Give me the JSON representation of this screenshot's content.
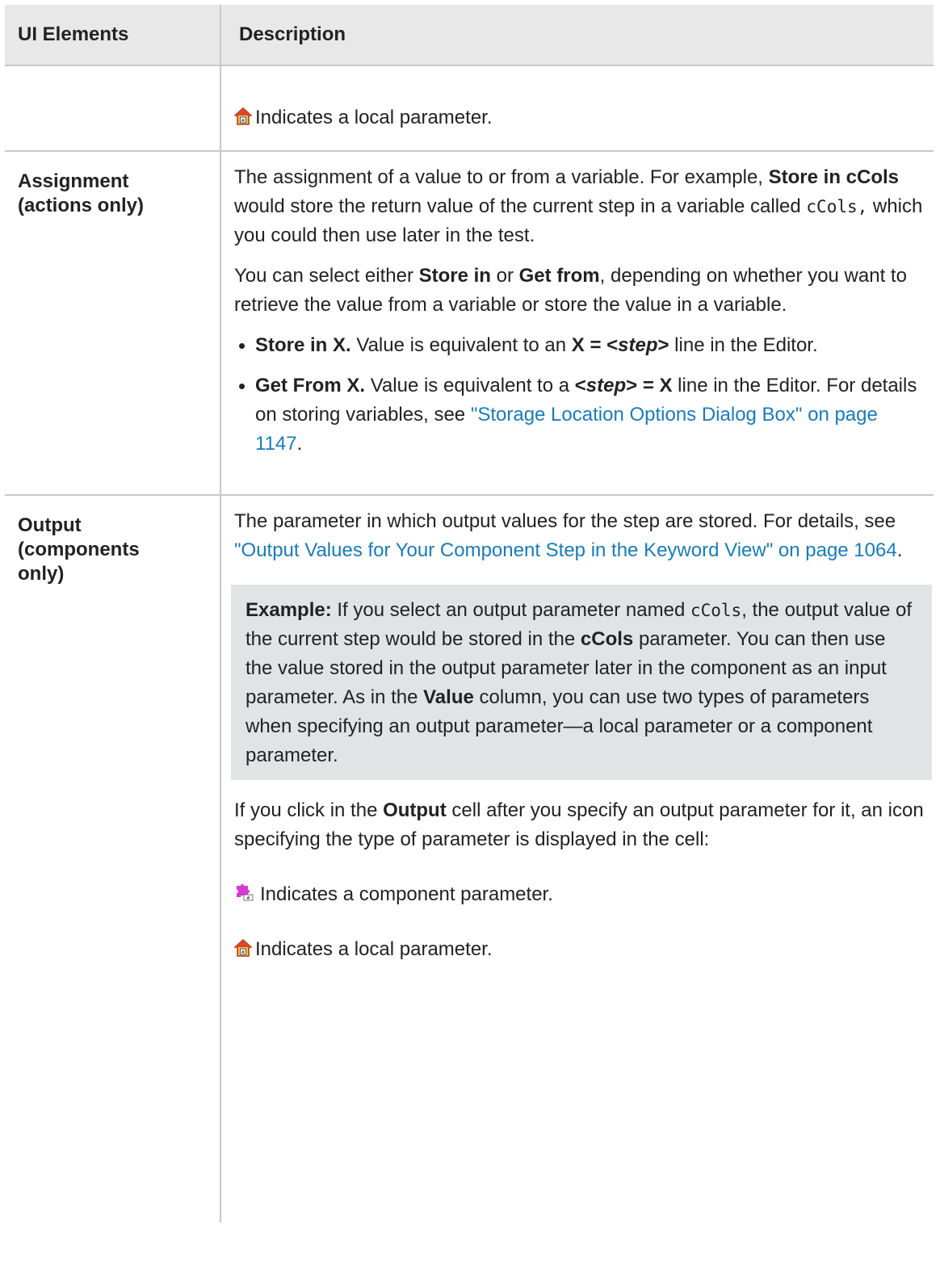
{
  "header": {
    "col1": "UI Elements",
    "col2": "Description"
  },
  "row0": {
    "local_param_text": "Indicates a local parameter."
  },
  "assignment": {
    "label_line1": "Assignment",
    "label_line2": "(actions only)",
    "p1_a": "The assignment of a value to or from a variable. For example, ",
    "p1_bold": "Store in cCols",
    "p1_b": " would store the return value of the current step in a variable called ",
    "p1_code": "cCols,",
    "p1_c": " which you could then use later in the test.",
    "p2_a": "You can select either ",
    "p2_bold1": "Store in",
    "p2_b": " or ",
    "p2_bold2": "Get from",
    "p2_c": ", depending on whether you want to retrieve the value from a variable or store the value in a variable.",
    "b1_bold": "Store in X.",
    "b1_a": " Value is equivalent to an ",
    "b1_bold2": "X = <",
    "b1_italic": "step",
    "b1_bold3": ">",
    "b1_b": " line in the Editor.",
    "b2_bold": "Get From X.",
    "b2_a": " Value is equivalent to a ",
    "b2_bold2": "<",
    "b2_italic": "step",
    "b2_bold3": "> = X",
    "b2_b": " line in the Editor. For details on storing variables, see ",
    "b2_link": "\"Storage Location Options Dialog Box\" on page 1147",
    "b2_c": "."
  },
  "output": {
    "label_line1": "Output",
    "label_line2": "(components",
    "label_line3": "only)",
    "p1_a": "The parameter in which output values for the step are stored. For details, see ",
    "p1_link": "\"Output Values for Your Component Step in the Keyword View\" on page 1064",
    "p1_b": ".",
    "ex_bold": "Example:",
    "ex_a": " If you select an output parameter named ",
    "ex_code": "cCols",
    "ex_b": ", the output value of the current step would be stored in the ",
    "ex_bold2": "cCols",
    "ex_c": " parameter. You can then use the value stored in the output parameter later in the component as an input parameter. As in the ",
    "ex_bold3": "Value",
    "ex_d": " column, you can use two types of parameters when specifying an output parameter—a local parameter or a component parameter.",
    "p2_a": "If you click in the ",
    "p2_bold": "Output",
    "p2_b": " cell after you specify an output parameter for it, an icon specifying the type of parameter is displayed in the cell:",
    "component_param_text": "Indicates a component parameter.",
    "local_param_text": "Indicates a local parameter."
  },
  "icons": {
    "local": "local-parameter-icon",
    "component": "component-parameter-icon"
  }
}
